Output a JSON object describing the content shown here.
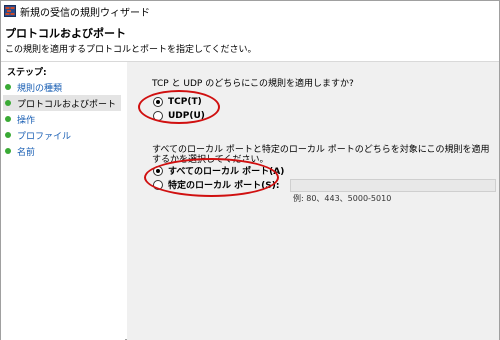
{
  "window": {
    "title": "新規の受信の規則ウィザード",
    "icon": "firewall-icon"
  },
  "header": {
    "title": "プロトコルおよびポート",
    "description": "この規則を適用するプロトコルとポートを指定してください。"
  },
  "sidebar": {
    "steps_label": "ステップ:",
    "items": [
      {
        "label": "規則の種類",
        "current": false
      },
      {
        "label": "プロトコルおよびポート",
        "current": true
      },
      {
        "label": "操作",
        "current": false
      },
      {
        "label": "プロファイル",
        "current": false
      },
      {
        "label": "名前",
        "current": false
      }
    ]
  },
  "main": {
    "protocol_question": "TCP と UDP のどちらにこの規則を適用しますか?",
    "protocol_options": [
      {
        "label": "TCP(T)",
        "checked": true
      },
      {
        "label": "UDP(U)",
        "checked": false
      }
    ],
    "port_question": "すべてのローカル ポートと特定のローカル ポートのどちらを対象にこの規則を適用するかを選択してください。",
    "port_options": [
      {
        "label": "すべてのローカル ポート(A)",
        "checked": true
      },
      {
        "label": "特定のローカル ポート(S):",
        "checked": false
      }
    ],
    "port_input_value": "",
    "port_example": "例: 80、443、5000-5010"
  },
  "colors": {
    "annotation": "#d01010",
    "step_dot": "#3aaa35",
    "link": "#1a5fb4",
    "main_bg": "#f0f0f0"
  }
}
